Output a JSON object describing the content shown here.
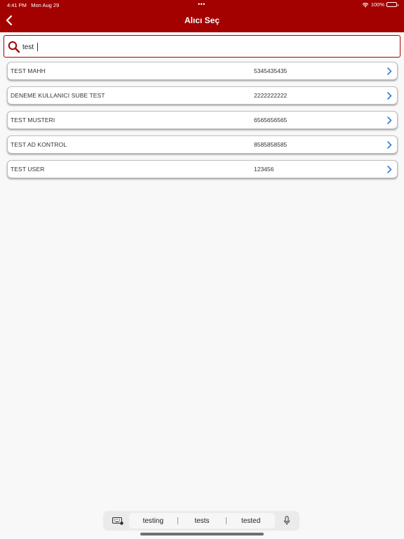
{
  "status_bar": {
    "time": "4:41 PM",
    "date": "Mon Aug 29",
    "battery": "100%",
    "wifi_icon": "wifi-icon",
    "battery_icon": "battery-icon"
  },
  "nav": {
    "title": "Alıcı Seç",
    "back_icon": "chevron-left-icon"
  },
  "search": {
    "value": "test",
    "icon": "search-icon"
  },
  "recipients": [
    {
      "name": "TEST MAHH",
      "phone": "5345435435"
    },
    {
      "name": "DENEME KULLANICI SUBE TEST",
      "phone": "2222222222"
    },
    {
      "name": "TEST MUSTERI",
      "phone": "6565656565"
    },
    {
      "name": "TEST AD KONTROL",
      "phone": "8585858585"
    },
    {
      "name": "TEST USER",
      "phone": "123456"
    }
  ],
  "keyboard": {
    "suggestions": [
      "testing",
      "tests",
      "tested"
    ],
    "keyboard_icon": "keyboard-icon",
    "mic_icon": "microphone-icon"
  },
  "colors": {
    "brand": "#a30000",
    "chevron": "#2f7fd0",
    "background": "#f8f8f8"
  }
}
